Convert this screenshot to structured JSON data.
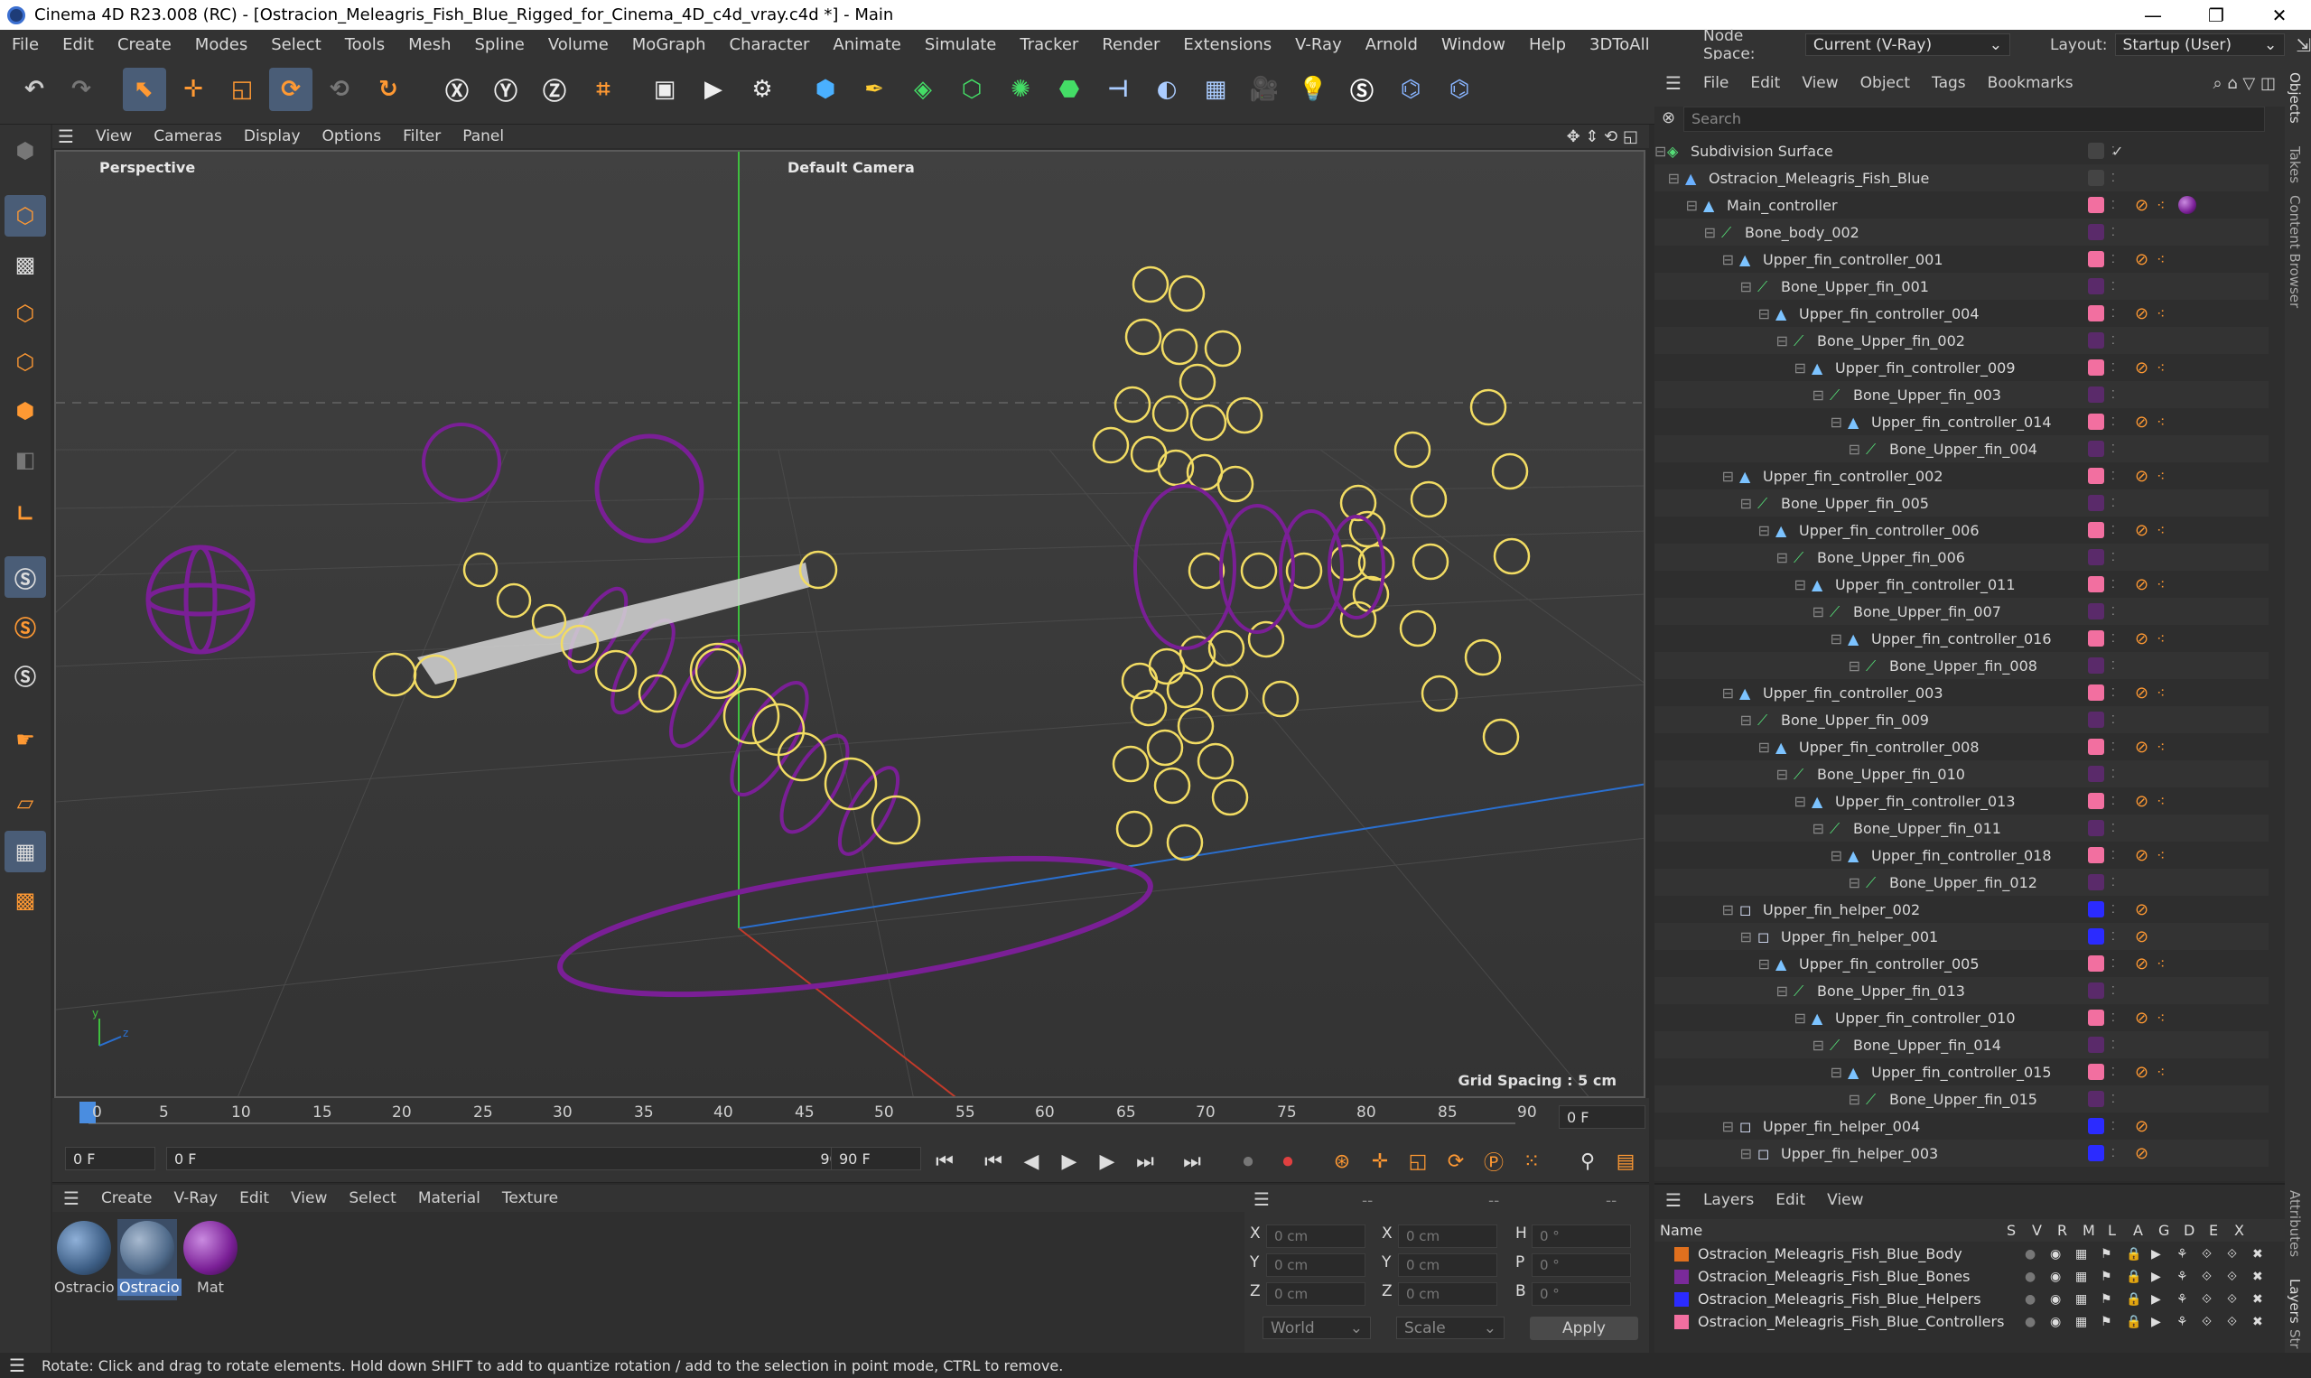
{
  "window": {
    "title": "Cinema 4D R23.008 (RC) - [Ostracion_Meleagris_Fish_Blue_Rigged_for_Cinema_4D_c4d_vray.c4d *] - Main",
    "min": "—",
    "max": "❐",
    "close": "✕"
  },
  "menu": [
    "File",
    "Edit",
    "Create",
    "Modes",
    "Select",
    "Tools",
    "Mesh",
    "Spline",
    "Volume",
    "MoGraph",
    "Character",
    "Animate",
    "Simulate",
    "Tracker",
    "Render",
    "Extensions",
    "V-Ray",
    "Arnold",
    "Window",
    "Help",
    "3DToAll"
  ],
  "nodespace": {
    "label": "Node Space:",
    "value": "Current (V-Ray)",
    "layout_label": "Layout:",
    "layout_value": "Startup (User)"
  },
  "viewport": {
    "menu": [
      "View",
      "Cameras",
      "Display",
      "Options",
      "Filter",
      "Panel"
    ],
    "projection": "Perspective",
    "camera": "Default Camera",
    "grid_spacing": "Grid Spacing : 5 cm"
  },
  "timeline": {
    "ticks": [
      "0",
      "5",
      "10",
      "15",
      "20",
      "25",
      "30",
      "35",
      "40",
      "45",
      "50",
      "55",
      "60",
      "65",
      "70",
      "75",
      "80",
      "85",
      "90"
    ],
    "current": "0 F",
    "start": "0 F",
    "range_start": "0 F",
    "range_end": "90 F",
    "end": "90 F"
  },
  "material_menu": [
    "Create",
    "V-Ray",
    "Edit",
    "View",
    "Select",
    "Material",
    "Texture"
  ],
  "materials": [
    {
      "name": "Ostracio",
      "color": "#3d5e85"
    },
    {
      "name": "Ostracio",
      "color": "#4f6a8a"
    },
    {
      "name": "Mat",
      "color": "#7a1f96"
    }
  ],
  "coords": {
    "header_a": "--",
    "header_b": "--",
    "header_c": "--",
    "rows": [
      {
        "a": "X",
        "av": "0 cm",
        "b": "X",
        "bv": "0 cm",
        "c": "H",
        "cv": "0 °"
      },
      {
        "a": "Y",
        "av": "0 cm",
        "b": "Y",
        "bv": "0 cm",
        "c": "P",
        "cv": "0 °"
      },
      {
        "a": "Z",
        "av": "0 cm",
        "b": "Z",
        "bv": "0 cm",
        "c": "B",
        "cv": "0 °"
      }
    ],
    "world": "World",
    "scale": "Scale",
    "apply": "Apply"
  },
  "objects_menu": [
    "File",
    "Edit",
    "View",
    "Object",
    "Tags",
    "Bookmarks"
  ],
  "objects_search": "Search",
  "objects": [
    {
      "name": "Subdivision Surface",
      "depth": 0,
      "type": "subd"
    },
    {
      "name": "Ostracion_Meleagris_Fish_Blue",
      "depth": 1,
      "type": "mesh"
    },
    {
      "name": "Main_controller",
      "depth": 2,
      "type": "null"
    },
    {
      "name": "Bone_body_002",
      "depth": 3,
      "type": "bone"
    },
    {
      "name": "Upper_fin_controller_001",
      "depth": 4,
      "type": "null"
    },
    {
      "name": "Bone_Upper_fin_001",
      "depth": 5,
      "type": "bone"
    },
    {
      "name": "Upper_fin_controller_004",
      "depth": 6,
      "type": "null"
    },
    {
      "name": "Bone_Upper_fin_002",
      "depth": 7,
      "type": "bone"
    },
    {
      "name": "Upper_fin_controller_009",
      "depth": 8,
      "type": "null"
    },
    {
      "name": "Bone_Upper_fin_003",
      "depth": 9,
      "type": "bone"
    },
    {
      "name": "Upper_fin_controller_014",
      "depth": 10,
      "type": "null"
    },
    {
      "name": "Bone_Upper_fin_004",
      "depth": 11,
      "type": "bone"
    },
    {
      "name": "Upper_fin_controller_002",
      "depth": 4,
      "type": "null"
    },
    {
      "name": "Bone_Upper_fin_005",
      "depth": 5,
      "type": "bone"
    },
    {
      "name": "Upper_fin_controller_006",
      "depth": 6,
      "type": "null"
    },
    {
      "name": "Bone_Upper_fin_006",
      "depth": 7,
      "type": "bone"
    },
    {
      "name": "Upper_fin_controller_011",
      "depth": 8,
      "type": "null"
    },
    {
      "name": "Bone_Upper_fin_007",
      "depth": 9,
      "type": "bone"
    },
    {
      "name": "Upper_fin_controller_016",
      "depth": 10,
      "type": "null"
    },
    {
      "name": "Bone_Upper_fin_008",
      "depth": 11,
      "type": "bone"
    },
    {
      "name": "Upper_fin_controller_003",
      "depth": 4,
      "type": "null"
    },
    {
      "name": "Bone_Upper_fin_009",
      "depth": 5,
      "type": "bone"
    },
    {
      "name": "Upper_fin_controller_008",
      "depth": 6,
      "type": "null"
    },
    {
      "name": "Bone_Upper_fin_010",
      "depth": 7,
      "type": "bone"
    },
    {
      "name": "Upper_fin_controller_013",
      "depth": 8,
      "type": "null"
    },
    {
      "name": "Bone_Upper_fin_011",
      "depth": 9,
      "type": "bone"
    },
    {
      "name": "Upper_fin_controller_018",
      "depth": 10,
      "type": "null"
    },
    {
      "name": "Bone_Upper_fin_012",
      "depth": 11,
      "type": "bone"
    },
    {
      "name": "Upper_fin_helper_002",
      "depth": 4,
      "type": "helper"
    },
    {
      "name": "Upper_fin_helper_001",
      "depth": 5,
      "type": "helper"
    },
    {
      "name": "Upper_fin_controller_005",
      "depth": 6,
      "type": "null"
    },
    {
      "name": "Bone_Upper_fin_013",
      "depth": 7,
      "type": "bone"
    },
    {
      "name": "Upper_fin_controller_010",
      "depth": 8,
      "type": "null"
    },
    {
      "name": "Bone_Upper_fin_014",
      "depth": 9,
      "type": "bone"
    },
    {
      "name": "Upper_fin_controller_015",
      "depth": 10,
      "type": "null"
    },
    {
      "name": "Bone_Upper_fin_015",
      "depth": 11,
      "type": "bone"
    },
    {
      "name": "Upper_fin_helper_004",
      "depth": 4,
      "type": "helper"
    },
    {
      "name": "Upper_fin_helper_003",
      "depth": 5,
      "type": "helper"
    }
  ],
  "layers_menu": [
    "Layers",
    "Edit",
    "View"
  ],
  "layers_header": {
    "name": "Name",
    "cols": [
      "S",
      "V",
      "R",
      "M",
      "L",
      "A",
      "G",
      "D",
      "E",
      "X"
    ]
  },
  "layers": [
    {
      "name": "Ostracion_Meleagris_Fish_Blue_Body",
      "color": "#e0701e"
    },
    {
      "name": "Ostracion_Meleagris_Fish_Blue_Bones",
      "color": "#7a2a9a"
    },
    {
      "name": "Ostracion_Meleagris_Fish_Blue_Helpers",
      "color": "#2b2bff"
    },
    {
      "name": "Ostracion_Meleagris_Fish_Blue_Controllers",
      "color": "#f26fa0"
    }
  ],
  "right_tabs": [
    "Objects",
    "Takes",
    "Content Browser",
    "Attributes",
    "Layers",
    "Str"
  ],
  "status": "Rotate: Click and drag to rotate elements. Hold down SHIFT to add to quantize rotation / add to the selection in point mode, CTRL to remove."
}
